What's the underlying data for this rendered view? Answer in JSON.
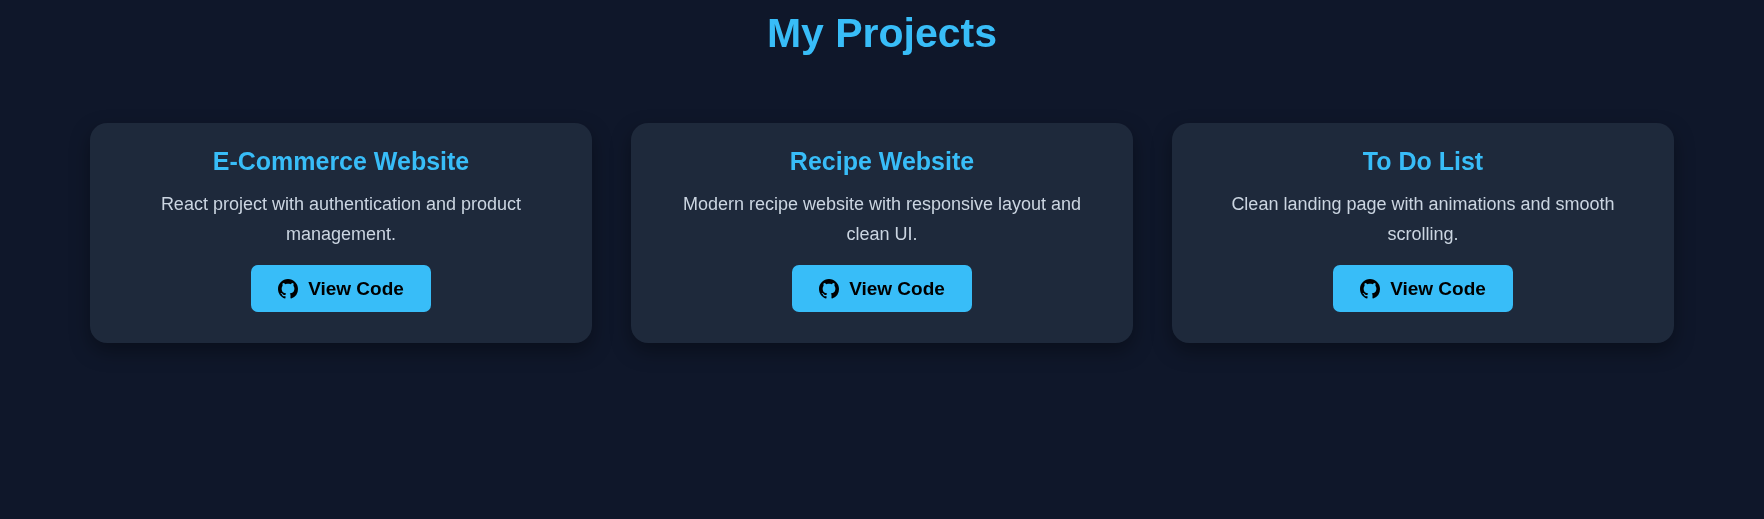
{
  "title": "My Projects",
  "projects": [
    {
      "name": "E-Commerce Website",
      "description": "React project with authentication and product management.",
      "button": "View Code"
    },
    {
      "name": "Recipe Website",
      "description": "Modern recipe website with responsive layout and clean UI.",
      "button": "View Code"
    },
    {
      "name": "To Do List",
      "description": "Clean landing page with animations and smooth scrolling.",
      "button": "View Code"
    }
  ]
}
